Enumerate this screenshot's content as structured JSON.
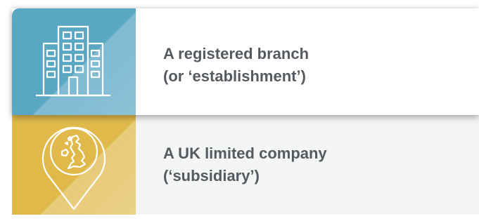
{
  "options": [
    {
      "icon": "office-building-icon",
      "line1": "A registered branch",
      "line2": "(or ‘establishment’)",
      "tile_color": "#5aa7c4"
    },
    {
      "icon": "uk-map-pin-icon",
      "line1": "A UK limited company",
      "line2": "(‘subsidiary’)",
      "tile_color": "#e0b94a"
    }
  ],
  "colors": {
    "text": "#555a61",
    "row1_background": "#ffffff",
    "row2_background": "#f4f5f5"
  }
}
